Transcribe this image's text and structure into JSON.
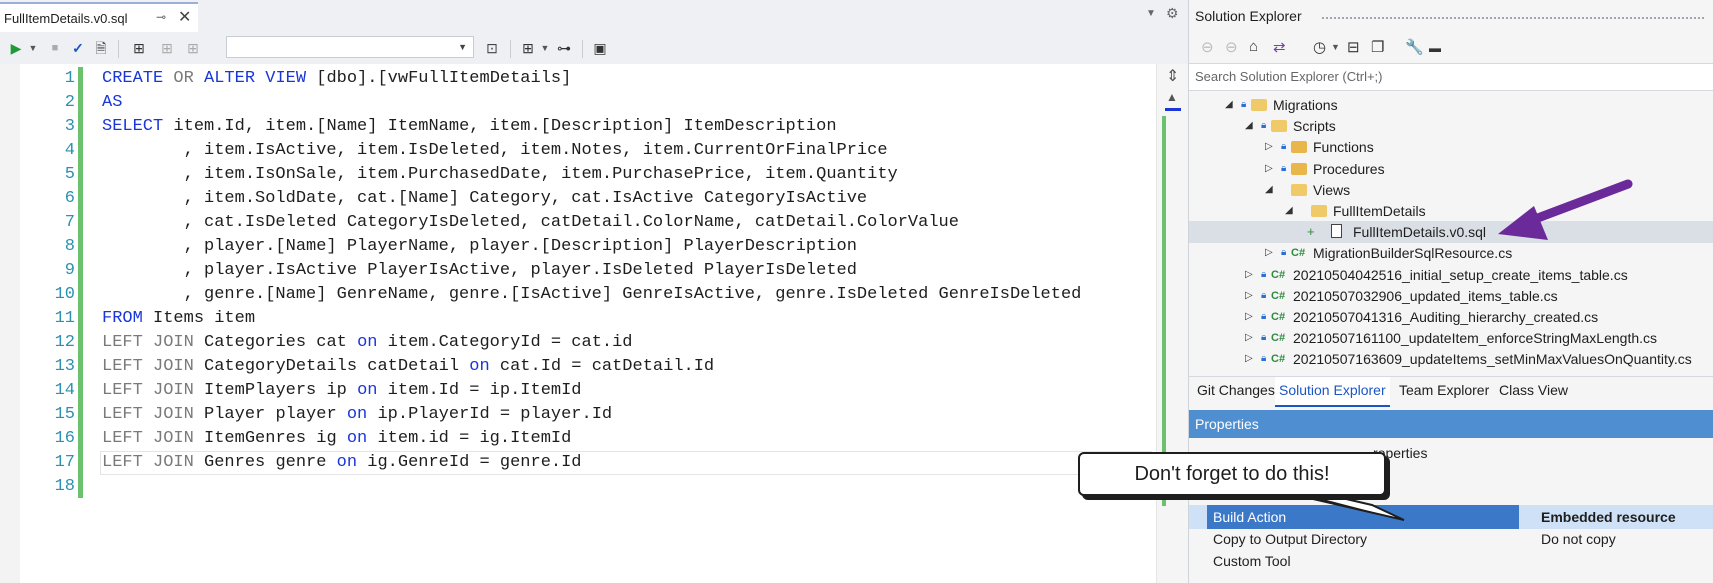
{
  "document_tab": {
    "title": "FullItemDetails.v0.sql",
    "pin": "⊸",
    "close": "✕"
  },
  "editor": {
    "line_numbers": [
      "1",
      "2",
      "3",
      "4",
      "5",
      "6",
      "7",
      "8",
      "9",
      "10",
      "11",
      "12",
      "13",
      "14",
      "15",
      "16",
      "17",
      "18"
    ],
    "lines": [
      [
        [
          "k",
          "CREATE"
        ],
        [
          "t",
          " "
        ],
        [
          "g",
          "OR"
        ],
        [
          "t",
          " "
        ],
        [
          "k",
          "ALTER VIEW"
        ],
        [
          "t",
          " [dbo].[vwFullItemDetails]"
        ]
      ],
      [
        [
          "k",
          "AS"
        ]
      ],
      [
        [
          "k",
          "SELECT"
        ],
        [
          "t",
          " item.Id, item.[Name] ItemName, item.[Description] ItemDescription"
        ]
      ],
      [
        [
          "t",
          "        , item.IsActive, item.IsDeleted, item.Notes, item.CurrentOrFinalPrice"
        ]
      ],
      [
        [
          "t",
          "        , item.IsOnSale, item.PurchasedDate, item.PurchasePrice, item.Quantity"
        ]
      ],
      [
        [
          "t",
          "        , item.SoldDate, cat.[Name] Category, cat.IsActive CategoryIsActive"
        ]
      ],
      [
        [
          "t",
          "        , cat.IsDeleted CategoryIsDeleted, catDetail.ColorName, catDetail.ColorValue"
        ]
      ],
      [
        [
          "t",
          "        , player.[Name] PlayerName, player.[Description] PlayerDescription"
        ]
      ],
      [
        [
          "t",
          "        , player.IsActive PlayerIsActive, player.IsDeleted PlayerIsDeleted"
        ]
      ],
      [
        [
          "t",
          "        , genre.[Name] GenreName, genre.[IsActive] GenreIsActive, genre.IsDeleted GenreIsDeleted"
        ]
      ],
      [
        [
          "k",
          "FROM"
        ],
        [
          "t",
          " Items item"
        ]
      ],
      [
        [
          "g",
          "LEFT JOIN"
        ],
        [
          "t",
          " Categories cat "
        ],
        [
          "k",
          "on"
        ],
        [
          "t",
          " item.CategoryId = cat.id"
        ]
      ],
      [
        [
          "g",
          "LEFT JOIN"
        ],
        [
          "t",
          " CategoryDetails catDetail "
        ],
        [
          "k",
          "on"
        ],
        [
          "t",
          " cat.Id = catDetail.Id"
        ]
      ],
      [
        [
          "g",
          "LEFT JOIN"
        ],
        [
          "t",
          " ItemPlayers ip "
        ],
        [
          "k",
          "on"
        ],
        [
          "t",
          " item.Id = ip.ItemId"
        ]
      ],
      [
        [
          "g",
          "LEFT JOIN"
        ],
        [
          "t",
          " Player player "
        ],
        [
          "k",
          "on"
        ],
        [
          "t",
          " ip.PlayerId = player.Id"
        ]
      ],
      [
        [
          "g",
          "LEFT JOIN"
        ],
        [
          "t",
          " ItemGenres ig "
        ],
        [
          "k",
          "on"
        ],
        [
          "t",
          " item.id = ig.ItemId"
        ]
      ],
      [
        [
          "g",
          "LEFT JOIN"
        ],
        [
          "t",
          " Genres genre "
        ],
        [
          "k",
          "on"
        ],
        [
          "t",
          " ig.GenreId = genre.Id"
        ]
      ],
      []
    ]
  },
  "solution_explorer": {
    "title": "Solution Explorer",
    "search_placeholder": "Search Solution Explorer (Ctrl+;)",
    "tree": [
      {
        "label": "Migrations",
        "indent": 2,
        "expander": "◢",
        "lock": true,
        "icon": "folder-open"
      },
      {
        "label": "Scripts",
        "indent": 3,
        "expander": "◢",
        "lock": true,
        "icon": "folder-open"
      },
      {
        "label": "Functions",
        "indent": 4,
        "expander": "▷",
        "lock": true,
        "icon": "folder"
      },
      {
        "label": "Procedures",
        "indent": 4,
        "expander": "▷",
        "lock": true,
        "icon": "folder"
      },
      {
        "label": "Views",
        "indent": 4,
        "expander": "◢",
        "lock": false,
        "icon": "folder-open"
      },
      {
        "label": "FullItemDetails",
        "indent": 5,
        "expander": "◢",
        "lock": false,
        "icon": "folder-open"
      },
      {
        "label": "FullItemDetails.v0.sql",
        "indent": 6,
        "expander": "",
        "lock": false,
        "icon": "sql-file",
        "plus": true,
        "selected": true
      },
      {
        "label": "MigrationBuilderSqlResource.cs",
        "indent": 4,
        "expander": "▷",
        "lock": true,
        "icon": "cs"
      },
      {
        "label": "20210504042516_initial_setup_create_items_table.cs",
        "indent": 3,
        "expander": "▷",
        "lock": true,
        "icon": "cs"
      },
      {
        "label": "20210507032906_updated_items_table.cs",
        "indent": 3,
        "expander": "▷",
        "lock": true,
        "icon": "cs"
      },
      {
        "label": "20210507041316_Auditing_hierarchy_created.cs",
        "indent": 3,
        "expander": "▷",
        "lock": true,
        "icon": "cs"
      },
      {
        "label": "20210507161100_updateItem_enforceStringMaxLength.cs",
        "indent": 3,
        "expander": "▷",
        "lock": true,
        "icon": "cs"
      },
      {
        "label": "20210507163609_updateItems_setMinMaxValuesOnQuantity.cs",
        "indent": 3,
        "expander": "▷",
        "lock": true,
        "icon": "cs"
      }
    ],
    "tabs": [
      "Git Changes",
      "Solution Explorer",
      "Team Explorer",
      "Class View"
    ],
    "active_tab": "Solution Explorer"
  },
  "properties": {
    "title": "Properties",
    "subtitle": "roperties",
    "rows": [
      {
        "name": "Build Action",
        "value": "Embedded resource",
        "selected": true
      },
      {
        "name": "Copy to Output Directory",
        "value": "Do not copy"
      },
      {
        "name": "Custom Tool",
        "value": ""
      }
    ]
  },
  "callout": {
    "text": "Don't forget to do this!"
  },
  "icons": {
    "run": "▶",
    "stop": "■",
    "check": "✓",
    "plan": "🗎",
    "explain": "⊞",
    "nav_back": "⊖",
    "nav_fwd": "⊖",
    "home": "⌂",
    "sync": "⇄",
    "history": "◷",
    "collapse": "⊟",
    "copy": "❐",
    "wrench": "🔧",
    "minus": "▬"
  },
  "colors": {
    "keyword": "#1a36d8",
    "line_number": "#2b91af",
    "change_bar": "#6cc26c",
    "properties_header": "#4e8ed1",
    "arrow": "#6b2a9a"
  }
}
